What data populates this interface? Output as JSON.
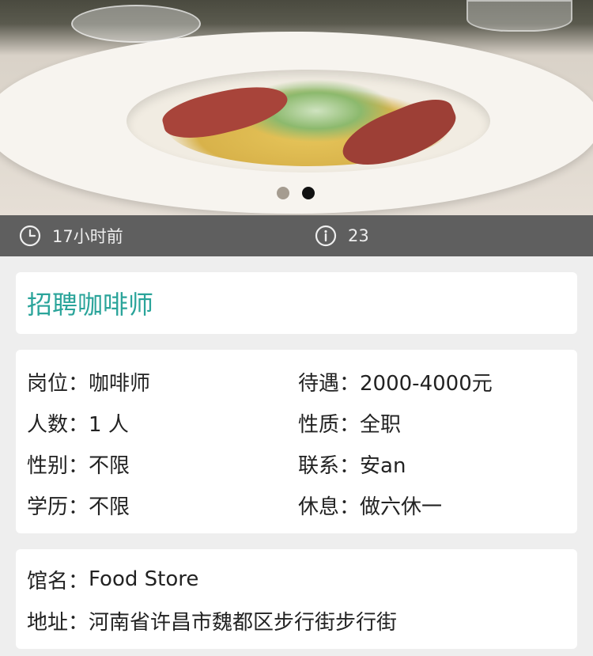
{
  "carousel": {
    "total": 2,
    "active_index": 1
  },
  "meta": {
    "posted_time": "17小时前",
    "views": "23"
  },
  "job": {
    "title": "招聘咖啡师",
    "details": [
      {
        "label": "岗位：",
        "value": "咖啡师"
      },
      {
        "label": "待遇：",
        "value": "2000-4000元"
      },
      {
        "label": "人数：",
        "value": "1 人"
      },
      {
        "label": "性质：",
        "value": "全职"
      },
      {
        "label": "性别：",
        "value": "不限"
      },
      {
        "label": "联系：",
        "value": "安an"
      },
      {
        "label": "学历：",
        "value": "不限"
      },
      {
        "label": "休息：",
        "value": "做六休一"
      }
    ]
  },
  "venue": {
    "name_label": "馆名：",
    "name": "Food Store",
    "address_label": "地址：",
    "address": "河南省许昌市魏都区步行街步行街"
  },
  "colors": {
    "title": "#2aa49a",
    "meta_bar": "#5f5f5f",
    "page_bg": "#eeeeee"
  }
}
